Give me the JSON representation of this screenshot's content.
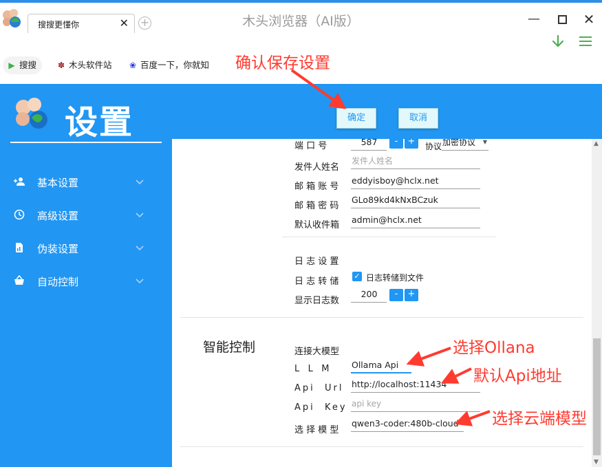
{
  "browser": {
    "window_title": "木头浏览器（AI版）",
    "tab_title": "搜搜更懂你",
    "tab_close": "✕",
    "tab_add": "+",
    "bookmarks": [
      {
        "label": "搜搜",
        "icon": "play-icon"
      },
      {
        "label": "木头软件站",
        "icon": "wood-logo-icon"
      },
      {
        "label": "百度一下，你就知",
        "icon": "paw-icon"
      }
    ]
  },
  "settings": {
    "title": "设置",
    "ok_label": "确定",
    "cancel_label": "取消",
    "nav": [
      {
        "label": "基本设置",
        "icon": "user-add-icon"
      },
      {
        "label": "高级设置",
        "icon": "clock-icon"
      },
      {
        "label": "伪装设置",
        "icon": "document-icon"
      },
      {
        "label": "自动控制",
        "icon": "basket-icon"
      }
    ],
    "mail": {
      "port_label": "端 口 号",
      "port_value": "587",
      "protocol_label": "协议",
      "protocol_value": "加密协议",
      "sender_label": "发件人姓名",
      "sender_placeholder": "发件人姓名",
      "account_label": "邮 箱 账 号",
      "account_value": "eddyisboy@hclx.net",
      "password_label": "邮 箱 密 码",
      "password_value": "GLo89kd4kNxBCzuk",
      "inbox_label": "默认收件箱",
      "inbox_value": "admin@hclx.net"
    },
    "log": {
      "settings_label": "日 志 设 置",
      "dump_label": "日 志 转 储",
      "dump_checkbox_label": "日志转储到文件",
      "dump_checked": true,
      "count_label": "显示日志数",
      "count_value": "200"
    },
    "ai": {
      "section_title": "智能控制",
      "connect_label": "连接大模型",
      "llm_label": "L   L   M",
      "llm_value": "Ollama Api",
      "url_label": "Api  Url",
      "url_value": "http://localhost:11434",
      "key_label": "Api  Key",
      "key_placeholder": "api key",
      "model_label": "选 择 模 型",
      "model_value": "qwen3-coder:480b-cloud"
    },
    "spin_minus": "-",
    "spin_plus": "+"
  },
  "annotations": {
    "save": "确认保存设置",
    "ollama": "选择Ollana",
    "api": "默认Api地址",
    "cloud": "选择云端模型"
  },
  "colors": {
    "accent": "#2196f3",
    "annotation": "#ff3b30",
    "button_bg": "#e3f8fb",
    "download_arrow": "#4caf50"
  }
}
